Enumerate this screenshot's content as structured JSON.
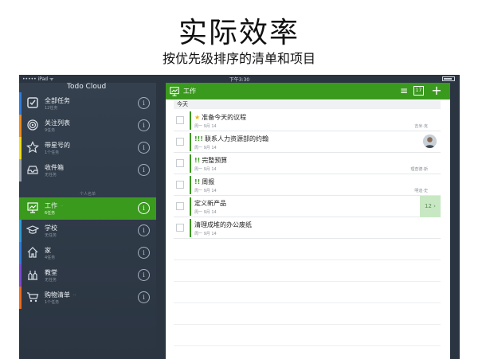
{
  "headline": "实际效率",
  "subline": "按优先级排序的清单和项目",
  "statusbar": {
    "left": "••••• iPad  ᯤ",
    "time": "下午3:30"
  },
  "sidebar": {
    "app_title": "Todo Cloud",
    "section_label": "个人名单",
    "items": [
      {
        "name": "全部任务",
        "count": "12任务",
        "color": "#2f7ddc",
        "icon": "checkbox-icon"
      },
      {
        "name": "关注列表",
        "count": "9任务",
        "color": "#ef8a1c",
        "icon": "target-icon"
      },
      {
        "name": "带星号的",
        "count": "1个任务",
        "color": "#f2df12",
        "icon": "star-icon"
      },
      {
        "name": "收件箱",
        "count": "无任务",
        "color": "#9aa3ad",
        "icon": "inbox-icon"
      },
      {
        "name": "工作",
        "count": "6任务",
        "color": "#3a9a1e",
        "icon": "presentation-icon",
        "shared": "ᐧᐧ"
      },
      {
        "name": "学校",
        "count": "无任务",
        "color": "#2f9dd6",
        "icon": "graduation-cap-icon"
      },
      {
        "name": "家",
        "count": "4任务",
        "color": "#2f7ddc",
        "icon": "house-icon"
      },
      {
        "name": "教堂",
        "count": "无任务",
        "color": "#7a4ad0",
        "icon": "church-icon"
      },
      {
        "name": "购物清单",
        "count": "1个任务",
        "color": "#ef6a1c",
        "icon": "cart-icon",
        "shared": "ᐧᐧ"
      }
    ]
  },
  "panel": {
    "title": "工作",
    "calendar_label": "17",
    "section": "今天",
    "tasks": [
      {
        "title": "准备今天的议程",
        "due": "周一 9月 14",
        "assignee": "吉米·克",
        "prefix": "★"
      },
      {
        "title": "联系人力资源部的约翰",
        "due": "周一 9月 14",
        "prefix": "!!!",
        "avatar": true
      },
      {
        "title": "完整预算",
        "due": "周一 9月 14",
        "assignee": "理查德·斯",
        "prefix": "!!"
      },
      {
        "title": "周报",
        "due": "周一 9月 14",
        "assignee": "明迪·史",
        "prefix": "!!"
      },
      {
        "title": "定义新产品",
        "due": "周一 9月 14",
        "badge": "12 ›"
      },
      {
        "title": "清理成堆的办公废纸",
        "due": "周一 9月 14"
      }
    ]
  }
}
